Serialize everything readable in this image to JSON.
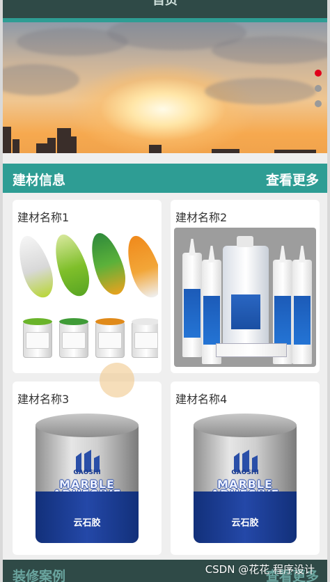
{
  "navbar": {
    "title": "首页"
  },
  "banner": {
    "dots_total": 3,
    "active_dot": 0
  },
  "section_materials": {
    "title": "建材信息",
    "more": "查看更多"
  },
  "products": [
    {
      "name": "建材名称1",
      "image": "paint-leaves"
    },
    {
      "name": "建材名称2",
      "image": "sealant-tubes"
    },
    {
      "name": "建材名称3",
      "image": "paint-bucket"
    },
    {
      "name": "建材名称4",
      "image": "paint-bucket"
    }
  ],
  "bucket_art": {
    "brand": "GAOSHI",
    "line1": "MARBLE",
    "line2": "ADHESIVE",
    "cn": "云石胶"
  },
  "section_cases": {
    "title": "装修案例",
    "more": "查看更多"
  },
  "watermark": "CSDN @花花 程序设计",
  "colors": {
    "accent": "#2e9d94",
    "nav": "#2f4a47",
    "active_dot": "#e0001a"
  }
}
